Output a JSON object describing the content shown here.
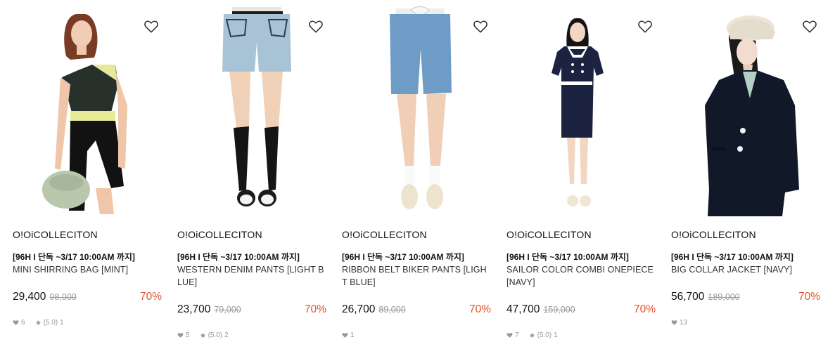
{
  "products": [
    {
      "brand": "O!OiCOLLECITON",
      "promo": "[96H I 단독 ~3/17 10:00AM 까지]",
      "name": "MINI SHIRRING BAG [MINT]",
      "price": "29,400",
      "original_price": "98,000",
      "discount": "70%",
      "likes": "6",
      "rating": "(5.0)",
      "reviews": "1"
    },
    {
      "brand": "O!OiCOLLECITON",
      "promo": "[96H I 단독 ~3/17 10:00AM 까지]",
      "name": "WESTERN DENIM PANTS [LIGHT BLUE]",
      "price": "23,700",
      "original_price": "79,000",
      "discount": "70%",
      "likes": "5",
      "rating": "(5.0)",
      "reviews": "2"
    },
    {
      "brand": "O!OiCOLLECITON",
      "promo": "[96H I 단독 ~3/17 10:00AM 까지]",
      "name": "RIBBON BELT BIKER PANTS [LIGHT BLUE]",
      "price": "26,700",
      "original_price": "89,000",
      "discount": "70%",
      "likes": "1"
    },
    {
      "brand": "O!OiCOLLECITON",
      "promo": "[96H I 단독 ~3/17 10:00AM 까지]",
      "name": "SAILOR COLOR COMBI ONEPIECE [NAVY]",
      "price": "47,700",
      "original_price": "159,000",
      "discount": "70%",
      "likes": "7",
      "rating": "(5.0)",
      "reviews": "1"
    },
    {
      "brand": "O!OiCOLLECITON",
      "promo": "[96H I 단독 ~3/17 10:00AM 까지]",
      "name": "BIG COLLAR JACKET [NAVY]",
      "price": "56,700",
      "original_price": "189,000",
      "discount": "70%",
      "likes": "13"
    }
  ],
  "icons": {
    "wishlist": "heart-outline-icon",
    "likes": "heart-icon",
    "rating": "star-icon"
  },
  "colors": {
    "discount": "#e8522b",
    "strike": "#999999",
    "text": "#111111"
  }
}
